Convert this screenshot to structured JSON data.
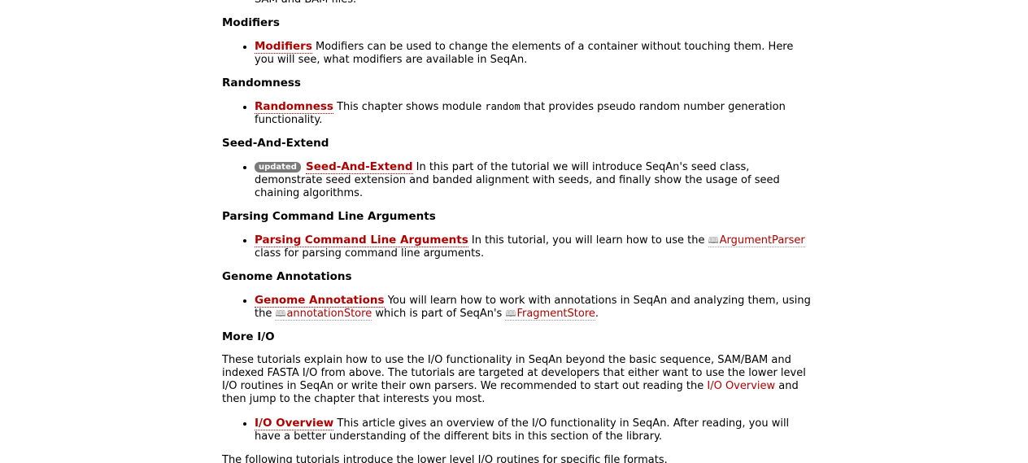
{
  "top_fragment": "SAM and BAM files.",
  "sections": {
    "modifiers": {
      "heading": "Modifiers",
      "link": "Modifiers",
      "text": "Modifiers can be used to change the elements of a container without touching them. Here you will see, what modifiers are available in SeqAn."
    },
    "randomness": {
      "heading": "Randomness",
      "link": "Randomness",
      "text_before": "This chapter shows module",
      "code": "random",
      "text_after": "that provides pseudo random number generation functionality."
    },
    "seed": {
      "heading": "Seed-And-Extend",
      "badge": "updated",
      "link": "Seed-And-Extend",
      "text": "In this part of the tutorial we will introduce SeqAn's seed class, demonstrate seed extension and banded alignment with seeds, and finally show the usage of seed chaining algorithms."
    },
    "parsing": {
      "heading": "Parsing Command Line Arguments",
      "link": "Parsing Command Line Arguments",
      "text_before": "In this tutorial, you will learn how to use the",
      "api_link": "ArgumentParser",
      "text_after": "class for parsing command line arguments."
    },
    "genome": {
      "heading": "Genome Annotations",
      "link": "Genome Annotations",
      "text_before": "You will learn how to work with annotations in SeqAn and analyzing them, using the",
      "api_link1": "annotationStore",
      "text_middle": "which is part of SeqAn's",
      "api_link2": "FragmentStore",
      "text_after": "."
    },
    "more_io": {
      "heading": "More I/O",
      "paragraph_before": "These tutorials explain how to use the I/O functionality in SeqAn beyond the basic sequence, SAM/BAM and indexed FASTA I/O from above. The tutorials are targeted at developers that either want to use the lower level I/O routines in SeqAn or write their own parsers. We recommended to start out reading the",
      "paragraph_link": "I/O Overview",
      "paragraph_after": "and then jump to the chapter that interests you most.",
      "link": "I/O Overview",
      "text": "This article gives an overview of the I/O functionality in SeqAn. After reading, you will have a better understanding of the different bits in this section of the library.",
      "bottom_text": "The following tutorials introduce the lower level I/O routines for specific file formats."
    }
  },
  "icons": {
    "api_book": "book-icon"
  },
  "colors": {
    "link": "#b00000",
    "badge": "#7a7a7a"
  }
}
